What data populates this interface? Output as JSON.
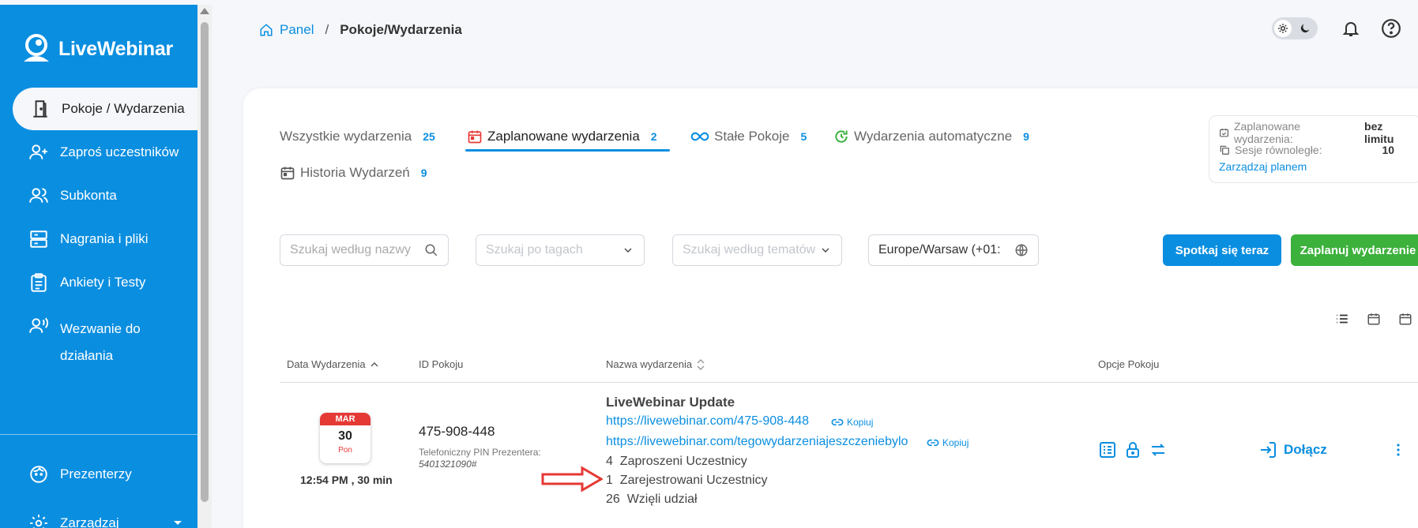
{
  "app": {
    "logo_text": "LiveWebinar"
  },
  "sidebar": {
    "items": [
      {
        "label": "Pokoje / Wydarzenia",
        "icon": "door-icon",
        "active": true
      },
      {
        "label": "Zaproś uczestników",
        "icon": "add-user-icon"
      },
      {
        "label": "Subkonta",
        "icon": "users-icon"
      },
      {
        "label": "Nagrania i pliki",
        "icon": "server-icon"
      },
      {
        "label": "Ankiety i Testy",
        "icon": "clipboard-icon"
      },
      {
        "label": "Wezwanie do",
        "label2": "działania",
        "icon": "speaking-user-icon"
      },
      {
        "label": "Prezenterzy",
        "icon": "face-icon"
      },
      {
        "label": "Zarządzaj",
        "icon": "gear-icon"
      }
    ]
  },
  "breadcrumb": {
    "home": "Panel",
    "separator": "/",
    "current": "Pokoje/Wydarzenia"
  },
  "tabs": [
    {
      "label": "Wszystkie wydarzenia",
      "count": "25"
    },
    {
      "label": "Zaplanowane wydarzenia",
      "count": "2",
      "active": true
    },
    {
      "label": "Stałe Pokoje",
      "count": "5"
    },
    {
      "label": "Wydarzenia automatyczne",
      "count": "9"
    },
    {
      "label": "Historia Wydarzeń",
      "count": "9"
    }
  ],
  "plan": {
    "scheduled_label": "Zaplanowane wydarzenia:",
    "scheduled_value": "bez limitu",
    "parallel_label": "Sesje równoległe:",
    "parallel_value": "10",
    "manage_link": "Zarządzaj planem"
  },
  "filters": {
    "search_placeholder": "Szukaj według nazwy",
    "tags_placeholder": "Szukaj po tagach",
    "topics_placeholder": "Szukaj według tematów",
    "timezone_value": "Europe/Warsaw (+01:"
  },
  "buttons": {
    "meet_now": "Spotkaj się teraz",
    "schedule": "Zaplanuj wydarzenie"
  },
  "table": {
    "headers": [
      "Data Wydarzenia",
      "ID Pokoju",
      "Nazwa wydarzenia",
      "Opcje Pokoju"
    ],
    "rows": [
      {
        "month": "MAR",
        "day": "30",
        "weekday": "Pon",
        "time": "12:54 PM , 30 min",
        "room_id": "475-908-448",
        "pin_label": "Telefoniczny PIN Prezentera:",
        "pin_value": "5401321090#",
        "title": "LiveWebinar Update",
        "link1": "https://livewebinar.com/475-908-448",
        "link2": "https://livewebinar.com/tegowydarzeniajeszczeniebylo",
        "copy_label": "Kopiuj",
        "invited_count": "4",
        "invited_label": "Zaproszeni Uczestnicy",
        "registered_count": "1",
        "registered_label": "Zarejestrowani Uczestnicy",
        "attended_count": "26",
        "attended_label": "Wzięli udział",
        "join_label": "Dołącz"
      }
    ]
  },
  "colors": {
    "primary": "#0a8ee0",
    "green": "#3cb13c",
    "red": "#e53935"
  }
}
